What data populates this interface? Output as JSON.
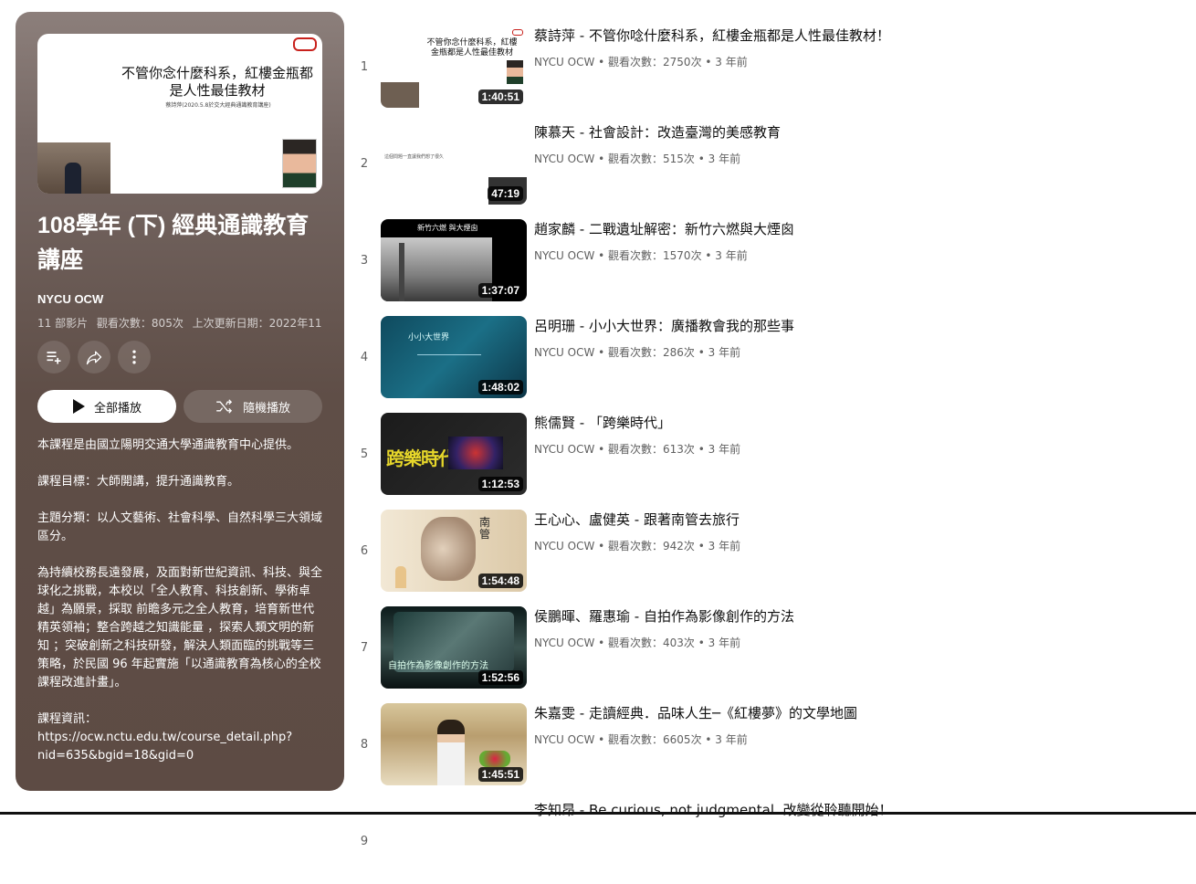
{
  "playlist": {
    "thumb_title": "不管你念什麼科系，紅樓金瓶都是人性最佳教材",
    "thumb_subtitle": "蔡詩萍(2020.5.8於交大經典通識教育講座)",
    "title": "108學年 (下) 經典通識教育講座",
    "channel": "NYCU OCW",
    "video_count": "11 部影片",
    "views": "觀看次數：805次",
    "updated": "上次更新日期：2022年11...",
    "play_all_label": "全部播放",
    "shuffle_label": "隨機播放",
    "description": "本課程是由國立陽明交通大學通識教育中心提供。\n\n課程目標：大師開講，提升通識教育。\n\n主題分類：以人文藝術、社會科學、自然科學三大領域區分。\n\n為持續校務長遠發展，及面對新世紀資訊、科技、與全球化之挑戰，本校以「全人教育、科技創新、學術卓越」為願景，採取 前瞻多元之全人教育，培育新世代精英領袖；整合跨越之知識能量 ，探索人類文明的新知 ；突破創新之科技研發，解決人類面臨的挑戰等三策略，於民國 96 年起實施「以通識教育為核心的全校課程改進計畫」。\n\n課程資訊：\nhttps://ocw.nctu.edu.tw/course_detail.php?nid=635&bgid=18&gid=0",
    "icons": [
      "add-to-queue-icon",
      "share-icon",
      "more-icon",
      "play-icon",
      "shuffle-icon"
    ]
  },
  "videos": [
    {
      "index": "1",
      "title": "蔡詩萍 - 不管你唸什麼科系，紅樓金瓶都是人性最佳教材！",
      "meta": "NYCU OCW • 觀看次數：2750次 • 3 年前",
      "duration": "1:40:51",
      "thumb_text": "不管你念什麼科系，紅樓金瓶都是人性最佳教材"
    },
    {
      "index": "2",
      "title": "陳慕天 - 社會設計：改造臺灣的美感教育",
      "meta": "NYCU OCW • 觀看次數：515次 • 3 年前",
      "duration": "47:19",
      "thumb_text": "這個問題一直讓我們想了很久"
    },
    {
      "index": "3",
      "title": "趙家麟 - 二戰遺址解密：新竹六燃與大煙囪",
      "meta": "NYCU OCW • 觀看次數：1570次 • 3 年前",
      "duration": "1:37:07",
      "thumb_text": "新竹六燃 與大煙囪"
    },
    {
      "index": "4",
      "title": "呂明珊 - 小小大世界：廣播教會我的那些事",
      "meta": "NYCU OCW • 觀看次數：286次 • 3 年前",
      "duration": "1:48:02",
      "thumb_text": "小小大世界"
    },
    {
      "index": "5",
      "title": "熊儒賢 - 「跨樂時代」",
      "meta": "NYCU OCW • 觀看次數：613次 • 3 年前",
      "duration": "1:12:53",
      "thumb_text": "跨樂時代"
    },
    {
      "index": "6",
      "title": "王心心、盧健英 - 跟著南管去旅行",
      "meta": "NYCU OCW • 觀看次數：942次 • 3 年前",
      "duration": "1:54:48",
      "thumb_text": "南管"
    },
    {
      "index": "7",
      "title": "侯鵬暉、羅惠瑜 - 自拍作為影像創作的方法",
      "meta": "NYCU OCW • 觀看次數：403次 • 3 年前",
      "duration": "1:52:56",
      "thumb_text": "自拍作為影像創作的方法"
    },
    {
      "index": "8",
      "title": "朱嘉雯 - 走讀經典．品味人生─《紅樓夢》的文學地圖",
      "meta": "NYCU OCW • 觀看次數：6605次 • 3 年前",
      "duration": "1:45:51",
      "thumb_text": ""
    },
    {
      "index": "9",
      "title": "李知昂 - Be curious, not judgmental. 改變從聆聽開始！",
      "meta": "",
      "duration": "",
      "thumb_text": ""
    }
  ]
}
